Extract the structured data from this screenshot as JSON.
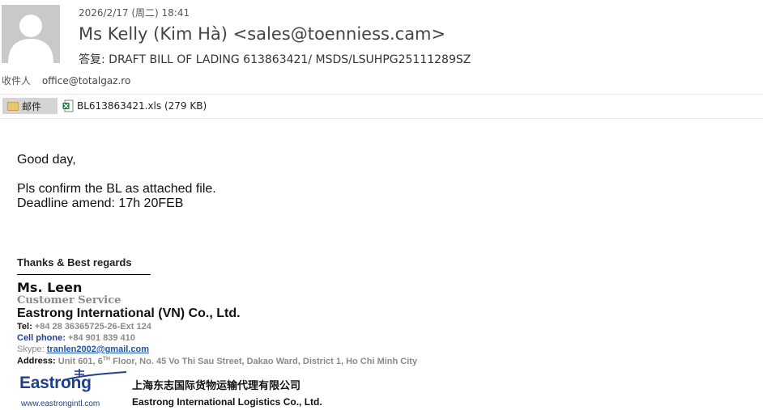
{
  "header": {
    "datetime": "2026/2/17 (周二) 18:41",
    "sender": "Ms Kelly (Kim Hà) <sales@toenniess.cam>",
    "subject": "答复: DRAFT BILL OF LADING 613863421/ MSDS/LSUHPG25111289SZ",
    "recipient_label": "收件人",
    "recipient_value": "office@totalgaz.ro"
  },
  "attachments": {
    "mail_tab_label": "邮件",
    "file_label": "BL613863421.xls (279 KB)",
    "file_icon": "excel-icon",
    "tab_icon": "envelope-icon"
  },
  "body": {
    "greeting": "Good day,",
    "line1": "Pls confirm the BL as attached file.",
    "line2": "Deadline amend: 17h 20FEB"
  },
  "signature": {
    "closing": "Thanks & Best regards",
    "name": "Ms. Leen",
    "role": "Customer Service",
    "company": "Eastrong International (VN) Co., Ltd.",
    "tel_label": "Tel:",
    "tel_value": "+84  28 36365725-26-Ext 124",
    "cell_label": "Cell phone:",
    "cell_value": "+84 901 839 410",
    "skype_label": "Skype:",
    "skype_value": "tranlen2002@gmail.com",
    "address_label": "Address:",
    "address_pre": "Unit 601, 6",
    "address_sup": "TH",
    "address_post": " Floor, No. 45 Vo Thi Sau Street, Dakao Ward, District 1, Ho Chi Minh City",
    "logo_text": "Eastrong",
    "logo_url": "www.eastrongintl.com",
    "company_cn": "上海东志国际货物运输代理有限公司",
    "company_en": "Eastrong International Logistics Co., Ltd."
  },
  "colors": {
    "brand_blue": "#1f3f8f",
    "link_blue": "#1a56b0",
    "signature_gray": "#8a8a8a"
  }
}
